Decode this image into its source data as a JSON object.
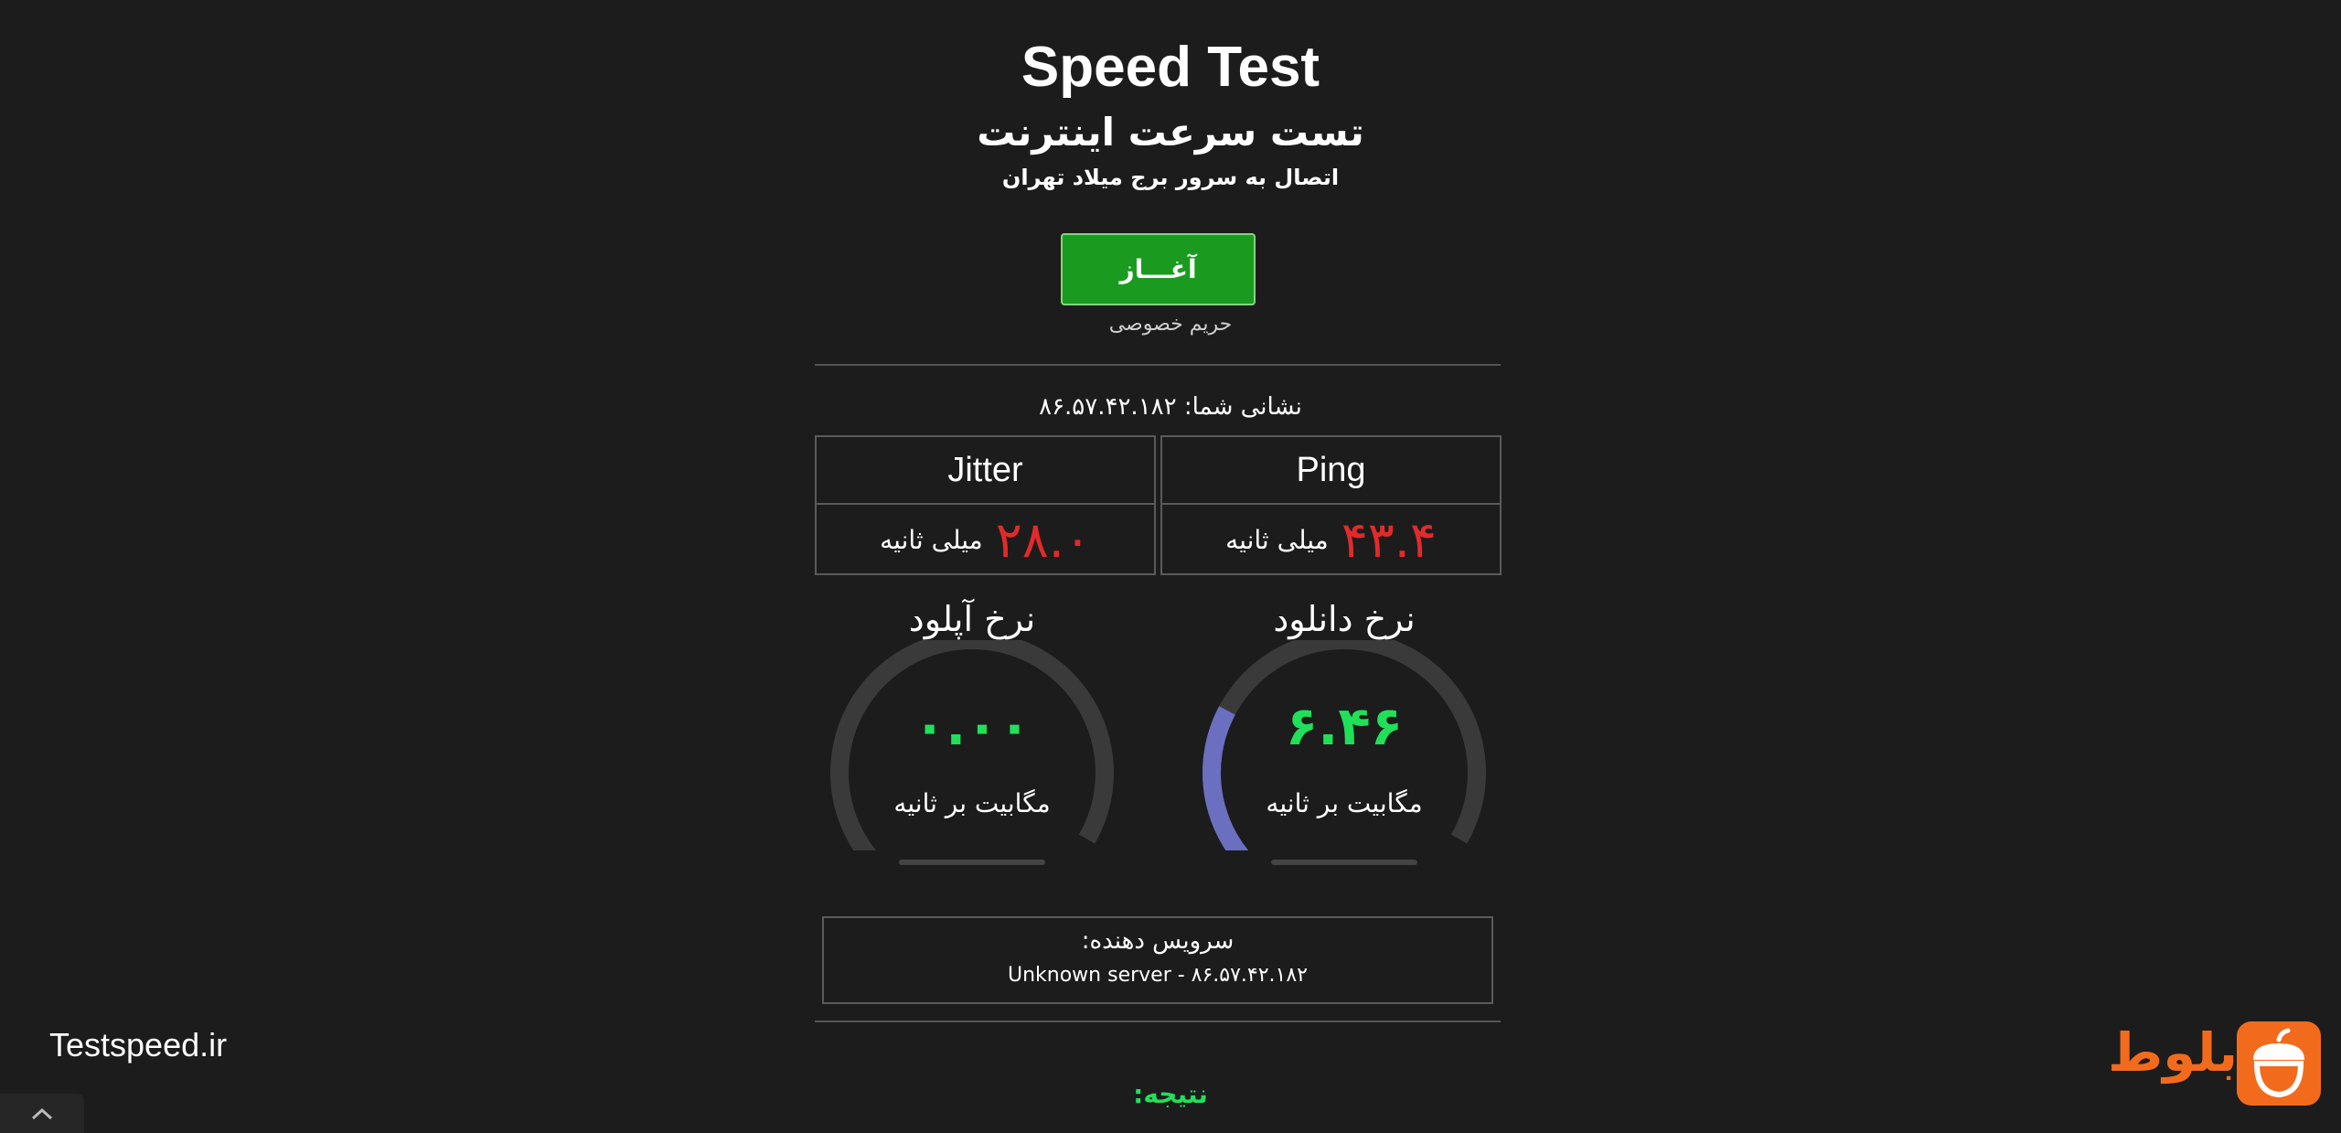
{
  "header": {
    "title": "Speed Test",
    "subtitle": "تست سرعت اینترنت",
    "server_line": "اتصال به سرور برج میلاد تهران"
  },
  "controls": {
    "start_label": "آغـــاز",
    "privacy_label": "حریم خصوصی"
  },
  "ip": {
    "text": "نشانی شما: ۸۶.۵۷.۴۲.۱۸۲"
  },
  "metrics": {
    "ping": {
      "label": "Ping",
      "value": "۴۳.۴",
      "unit": "میلی ثانیه"
    },
    "jitter": {
      "label": "Jitter",
      "value": "۲۸.۰",
      "unit": "میلی ثانیه"
    }
  },
  "gauges": {
    "download": {
      "title": "نرخ دانلود",
      "value": "۶.۴۶",
      "unit": "مگابیت بر ثانیه",
      "fill_fraction": 0.3
    },
    "upload": {
      "title": "نرخ آپلود",
      "value": "۰.۰۰",
      "unit": "مگابیت بر ثانیه",
      "fill_fraction": 0
    }
  },
  "provider": {
    "label": "سرویس دهنده:",
    "value": "Unknown server - ۸۶.۵۷.۴۲.۱۸۲"
  },
  "result": {
    "label": "نتیجه:"
  },
  "watermarks": {
    "site": "Testspeed.ir",
    "brand": "بلوط"
  },
  "colors": {
    "background": "#1c1c1c",
    "start_button": "#1a9b1f",
    "metric_value": "#e32a2a",
    "gauge_value": "#20e05a",
    "gauge_fill": "#6a6fc0",
    "gauge_track": "#3a3a3a",
    "brand": "#f26b1d"
  },
  "icons": {
    "scroll_up": "chevron-up-icon",
    "brand_logo": "acorn-icon"
  }
}
